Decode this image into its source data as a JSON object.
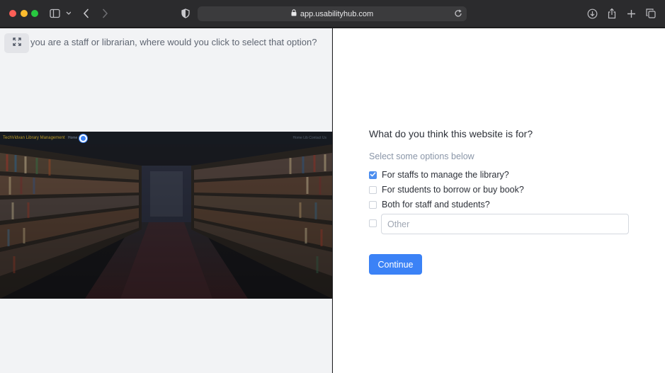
{
  "browser": {
    "url": "app.usabilityhub.com"
  },
  "task": {
    "question": "you are a staff or librarian, where would you click to select that option?"
  },
  "prototype": {
    "logo_text": "TechVidvan Library Management",
    "nav_home": "Home",
    "nav_links": "Home Lib   Contact Us"
  },
  "survey": {
    "title": "What do you think this website is for?",
    "hint": "Select some options below",
    "options": [
      {
        "label": "For staffs to manage the library?",
        "checked": true
      },
      {
        "label": "For students to borrow or buy book?",
        "checked": false
      },
      {
        "label": "Both for staff and students?",
        "checked": false
      }
    ],
    "other_placeholder": "Other",
    "other_checked": false,
    "continue_label": "Continue"
  },
  "colors": {
    "accent": "#3b82f6",
    "chrome_bg": "#2b2b2d",
    "left_pane_bg": "#f2f3f5"
  }
}
